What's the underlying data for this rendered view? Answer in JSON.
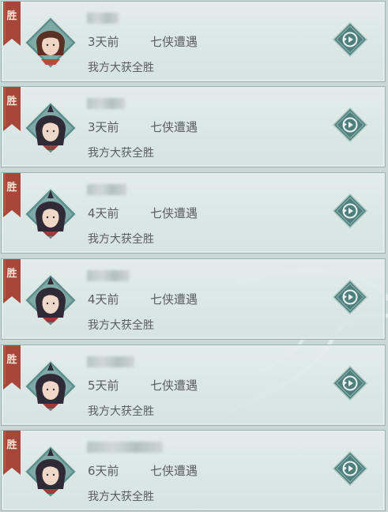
{
  "records": [
    {
      "badge": "胜",
      "time": "3天前",
      "mode": "七侠遭遇",
      "result": "我方大获全胜",
      "avatar": "avatar-brown-hair"
    },
    {
      "badge": "胜",
      "time": "3天前",
      "mode": "七侠遭遇",
      "result": "我方大获全胜",
      "avatar": "avatar-dark-hair"
    },
    {
      "badge": "胜",
      "time": "4天前",
      "mode": "七侠遭遇",
      "result": "我方大获全胜",
      "avatar": "avatar-dark-hair"
    },
    {
      "badge": "胜",
      "time": "4天前",
      "mode": "七侠遭遇",
      "result": "我方大获全胜",
      "avatar": "avatar-dark-hair"
    },
    {
      "badge": "胜",
      "time": "5天前",
      "mode": "七侠遭遇",
      "result": "我方大获全胜",
      "avatar": "avatar-dark-hair"
    },
    {
      "badge": "胜",
      "time": "6天前",
      "mode": "七侠遭遇",
      "result": "我方大获全胜",
      "avatar": "avatar-dark-hair"
    }
  ],
  "icons": {
    "replay": "replay-icon",
    "ribbon": "victory-ribbon"
  },
  "colors": {
    "ribbon": "#a8463a",
    "diamond": "#5f8f8c",
    "text": "#5a5e5e"
  }
}
